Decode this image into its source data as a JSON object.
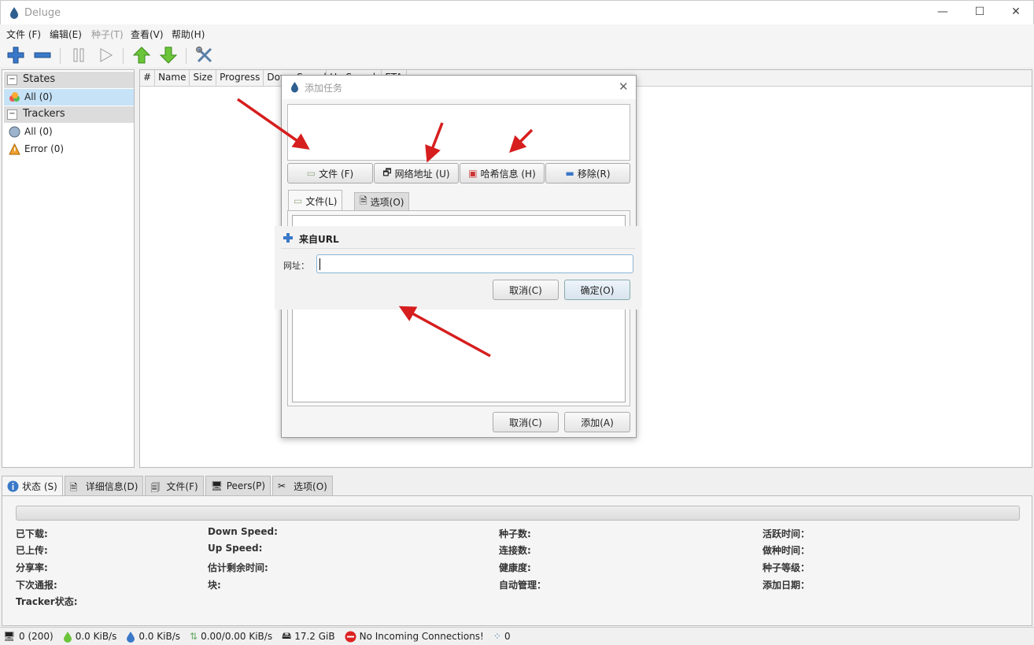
{
  "window": {
    "title": "Deluge"
  },
  "menubar": [
    "文件 (F)",
    "编辑(E)",
    "种子(T)",
    "查看(V)",
    "帮助(H)"
  ],
  "toolbar": {
    "icons": [
      "add-icon",
      "remove-icon",
      "pause-icon",
      "resume-icon",
      "queue-up-icon",
      "queue-down-icon",
      "preferences-icon"
    ]
  },
  "sidebar": {
    "states_header": "States",
    "states": [
      {
        "label": "All (0)",
        "selected": true
      }
    ],
    "trackers_header": "Trackers",
    "trackers": [
      {
        "label": "All (0)"
      },
      {
        "label": "Error (0)"
      }
    ]
  },
  "torrent_list": {
    "columns": [
      "#",
      "Name",
      "Size",
      "Progress",
      "Down Speed",
      "Up Speed",
      "ETA"
    ]
  },
  "bottom_tabs": [
    "状态 (S)",
    "详细信息(D)",
    "文件(F)",
    "Peers(P)",
    "选项(O)"
  ],
  "status_panel": {
    "col1": [
      "已下载:",
      "已上传:",
      "分享率:",
      "下次通报:",
      "Tracker状态:"
    ],
    "col2": [
      "Down Speed:",
      "Up Speed:",
      "估计剩余时间:",
      "块:"
    ],
    "col3": [
      "种子数:",
      "连接数:",
      "健康度:",
      "自动管理："
    ],
    "col4": [
      "活跃时间：",
      "做种时间：",
      "种子等级：",
      "添加日期："
    ]
  },
  "statusbar": {
    "connections": "0 (200)",
    "down_speed": "0.0 KiB/s",
    "up_speed": "0.0 KiB/s",
    "protocol": "0.00/0.00 KiB/s",
    "free_space": "17.2 GiB",
    "incoming": "No Incoming Connections!",
    "dht": "0"
  },
  "add_dialog": {
    "title": "添加任务",
    "buttons": [
      "文件 (F)",
      "网络地址 (U)",
      "哈希信息 (H)",
      "移除(R)"
    ],
    "tabs": [
      "文件(L)",
      "选项(O)"
    ],
    "cancel": "取消(C)",
    "add": "添加(A)"
  },
  "url_dialog": {
    "title": "来自URL",
    "label": "网址：",
    "value": "",
    "cancel": "取消(C)",
    "ok": "确定(O)"
  },
  "colors": {
    "selection": "#c6e2f7",
    "annotation_arrow": "#d61e1e",
    "accent": "#3a78c9"
  }
}
